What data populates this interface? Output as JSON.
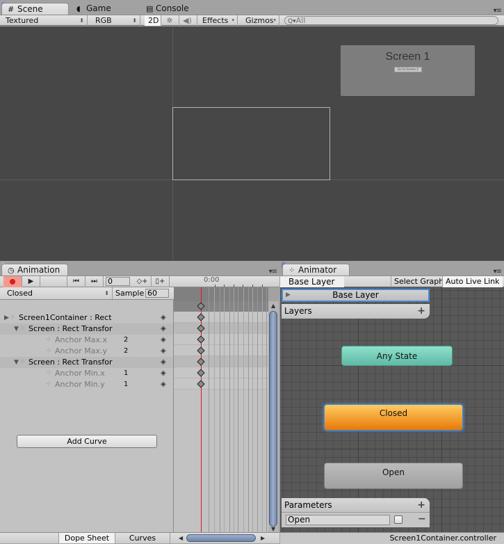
{
  "scene": {
    "tabs": [
      {
        "label": "Scene",
        "icon": "grid-icon",
        "active": true
      },
      {
        "label": "Game",
        "icon": "pacman-icon",
        "active": false
      },
      {
        "label": "Console",
        "icon": "console-icon",
        "active": false
      }
    ],
    "toolbar": {
      "draw_mode": "Textured",
      "render_mode": "RGB",
      "mode_2d": "2D",
      "lighting_icon": "sun-icon",
      "audio_icon": "speaker-icon",
      "effects": "Effects",
      "gizmos": "Gizmos",
      "search_placeholder": "All"
    },
    "screen1": {
      "title": "Screen 1",
      "button_label": "Go to Screen 2"
    }
  },
  "animation": {
    "tab_label": "Animation",
    "frame": "0",
    "time_label": "0:00",
    "clip": "Closed",
    "sample_label": "Sample",
    "sample_value": "60",
    "properties": [
      {
        "label": "Screen1Container : Rect",
        "indent": 0,
        "expander": "collapsed",
        "value": "",
        "dim": false
      },
      {
        "label": "Screen : Rect Transfor",
        "indent": 1,
        "expander": "expanded",
        "value": "",
        "dim": false
      },
      {
        "label": "Anchor Max.x",
        "indent": 2,
        "expander": "none",
        "value": "2",
        "dim": true
      },
      {
        "label": "Anchor Max.y",
        "indent": 2,
        "expander": "none",
        "value": "2",
        "dim": true
      },
      {
        "label": "Screen : Rect Transfor",
        "indent": 1,
        "expander": "expanded",
        "value": "",
        "dim": false
      },
      {
        "label": "Anchor Min.x",
        "indent": 2,
        "expander": "none",
        "value": "1",
        "dim": true
      },
      {
        "label": "Anchor Min.y",
        "indent": 2,
        "expander": "none",
        "value": "1",
        "dim": true
      }
    ],
    "add_curve": "Add Curve",
    "bottom_tabs": {
      "dope_sheet": "Dope Sheet",
      "curves": "Curves"
    }
  },
  "animator": {
    "tab_label": "Animator",
    "breadcrumb": "Base Layer",
    "select_graph": "Select Graph",
    "auto_live_link": "Auto Live Link",
    "layer_name": "Base Layer",
    "layers_label": "Layers",
    "states": {
      "any": "Any State",
      "closed": "Closed",
      "open": "Open"
    },
    "parameters_label": "Parameters",
    "parameters": [
      {
        "name": "Open",
        "type": "bool",
        "value": false
      }
    ],
    "controller_file": "Screen1Container.controller"
  },
  "colors": {
    "any_state": "#6fccb8",
    "default_state": "#f09a20",
    "selected_outline": "#3d88d8",
    "playhead": "#e21616",
    "record": "#d42020"
  }
}
